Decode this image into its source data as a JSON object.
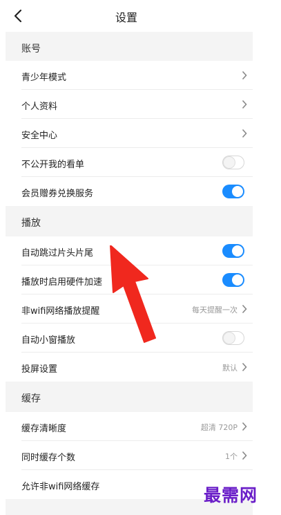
{
  "header": {
    "title": "设置",
    "back_icon": "chevron-left-icon"
  },
  "sections": {
    "account": {
      "title": "账号",
      "items": [
        {
          "label": "青少年模式",
          "type": "link"
        },
        {
          "label": "个人资料",
          "type": "link"
        },
        {
          "label": "安全中心",
          "type": "link"
        },
        {
          "label": "不公开我的看单",
          "type": "toggle",
          "on": false
        },
        {
          "label": "会员赠券兑换服务",
          "type": "toggle",
          "on": true
        }
      ]
    },
    "playback": {
      "title": "播放",
      "items": [
        {
          "label": "自动跳过片头片尾",
          "type": "toggle",
          "on": true
        },
        {
          "label": "播放时启用硬件加速",
          "type": "toggle",
          "on": true
        },
        {
          "label": "非wifi网络播放提醒",
          "type": "link",
          "value": "每天提醒一次"
        },
        {
          "label": "自动小窗播放",
          "type": "toggle",
          "on": false
        },
        {
          "label": "投屏设置",
          "type": "link",
          "value": "默认"
        }
      ]
    },
    "cache": {
      "title": "缓存",
      "items": [
        {
          "label": "缓存清晰度",
          "type": "link",
          "value": "超清 720P"
        },
        {
          "label": "同时缓存个数",
          "type": "link",
          "value": "1个"
        },
        {
          "label": "允许非wifi网络缓存",
          "type": "text"
        }
      ]
    }
  },
  "watermark": {
    "text": "最需网"
  },
  "colors": {
    "toggle_on": "#1a8cff",
    "section_bg": "#f4f4f4",
    "arrow": "#f0281e",
    "watermark": "#6a1ec8"
  }
}
